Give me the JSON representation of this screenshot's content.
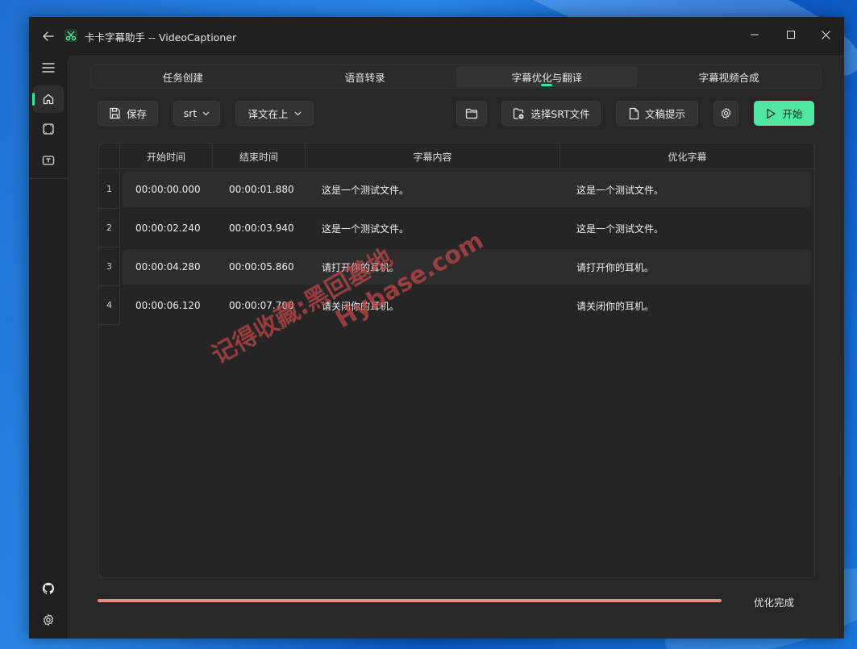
{
  "window": {
    "title": "卡卡字幕助手 -- VideoCaptioner"
  },
  "tabs": [
    {
      "label": "任务创建",
      "active": false
    },
    {
      "label": "语音转录",
      "active": false
    },
    {
      "label": "字幕优化与翻译",
      "active": true
    },
    {
      "label": "字幕视频合成",
      "active": false
    }
  ],
  "toolbar": {
    "save_label": "保存",
    "format_value": "srt",
    "layout_value": "译文在上",
    "select_srt_label": "选择SRT文件",
    "prompt_label": "文稿提示",
    "start_label": "开始"
  },
  "table": {
    "headers": [
      "开始时间",
      "结束时间",
      "字幕内容",
      "优化字幕"
    ],
    "rows": [
      {
        "num": "1",
        "start": "00:00:00.000",
        "end": "00:00:01.880",
        "content": "这是一个测试文件。",
        "optimized": "这是一个测试文件。"
      },
      {
        "num": "2",
        "start": "00:00:02.240",
        "end": "00:00:03.940",
        "content": "这是一个测试文件。",
        "optimized": "这是一个测试文件。"
      },
      {
        "num": "3",
        "start": "00:00:04.280",
        "end": "00:00:05.860",
        "content": "请打开你的耳机。",
        "optimized": "请打开你的耳机。"
      },
      {
        "num": "4",
        "start": "00:00:06.120",
        "end": "00:00:07.700",
        "content": "请关闭你的耳机。",
        "optimized": "请关闭你的耳机。"
      }
    ]
  },
  "progress": {
    "value": 1.0,
    "status": "优化完成"
  },
  "watermark": {
    "line1": "记得收藏:黑回基地",
    "line2": "Hybase.com"
  },
  "colors": {
    "accent": "#4ee6a0",
    "progress": "#f28c8c",
    "window_bg": "#202020",
    "content_bg": "#272727"
  },
  "icons": {
    "back": "arrow-left-icon",
    "app": "scissors-icon",
    "menu": "hamburger-icon",
    "home": "home-icon",
    "video": "film-icon",
    "text": "text-box-icon",
    "github": "github-icon",
    "settings": "gear-icon",
    "save": "save-icon",
    "folder": "folder-icon",
    "select_file": "file-gear-icon",
    "document": "document-icon",
    "start": "play-icon"
  }
}
